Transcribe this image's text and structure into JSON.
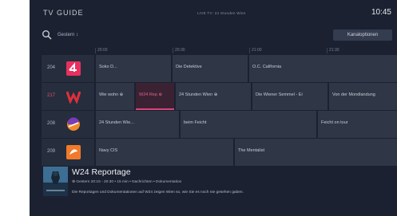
{
  "header": {
    "title": "TV GUIDE",
    "live": "LIVE TV: 24 Stunden Wien",
    "clock": "10:45"
  },
  "toolbar": {
    "day": "Gestern ↕",
    "options": "Kanaloptionen"
  },
  "timeline": [
    "20:00",
    "20:30",
    "21:00",
    "21:30"
  ],
  "channels": [
    {
      "number": "204",
      "logo": "sixx-icon",
      "programs": [
        "Soko D...",
        "Die Detektive",
        "O.C. California"
      ]
    },
    {
      "number": "217",
      "logo": "w24-icon",
      "programs": [
        "Wie wohn ⊕",
        "W24 Rep ⊕",
        "24 Stunden Wien ⊕",
        "Die Wiener Semmel - Ei",
        "Von der Mondlandung"
      ]
    },
    {
      "number": "208",
      "logo": "puls24-icon",
      "programs": [
        "24 Stunden Wie...",
        "beim Feicht",
        "Feicht on tour"
      ]
    },
    {
      "number": "209",
      "logo": "atv2-icon",
      "programs": [
        "Navy CIS",
        "The Mentalist"
      ]
    }
  ],
  "selected_channel_index": 1,
  "selected_program_index": 1,
  "details": {
    "title": "W24 Reportage",
    "meta": "⊕ Gestern 20:15 - 20:30  •  15 min  •  Nachrichten  •  Dokumentation",
    "description": "Die Reportagen und Dokumentationen auf W24 zeigen Wien so, wie Sie es noch nie gesehen gaben."
  },
  "colors": {
    "background": "#1b2130",
    "accent": "#d8457a",
    "cell": "#2f3646"
  }
}
